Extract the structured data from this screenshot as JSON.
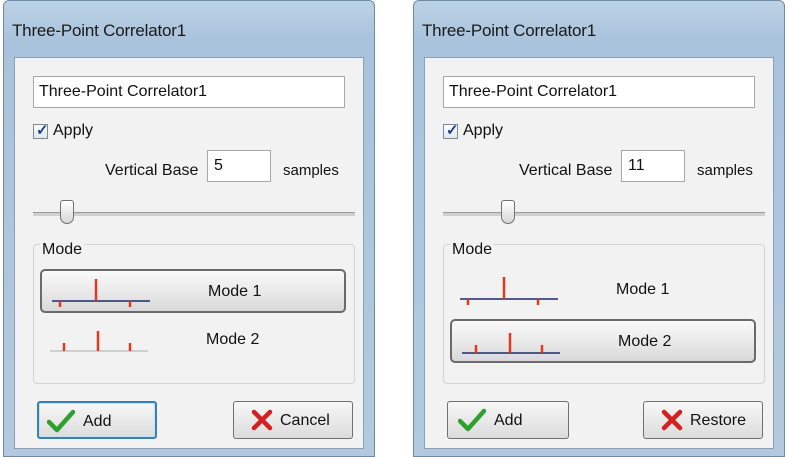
{
  "left": {
    "title": "Three-Point Correlator1",
    "name_value": "Three-Point Correlator1",
    "apply_label": "Apply",
    "vertical_base_label": "Vertical Base",
    "vertical_base_value": "5",
    "samples_label": "samples",
    "mode_label": "Mode",
    "mode1_label": "Mode 1",
    "mode2_label": "Mode 2",
    "selected_mode": "Mode 1",
    "add_label": "Add",
    "cancel_label": "Cancel"
  },
  "right": {
    "title": "Three-Point Correlator1",
    "name_value": "Three-Point Correlator1",
    "apply_label": "Apply",
    "vertical_base_label": "Vertical Base",
    "vertical_base_value": "11",
    "samples_label": "samples",
    "mode_label": "Mode",
    "mode1_label": "Mode 1",
    "mode2_label": "Mode 2",
    "selected_mode": "Mode 2",
    "add_label": "Add",
    "restore_label": "Restore"
  },
  "icons": {
    "checkbox_checked": "checkmark",
    "add": "green-checkmark-icon",
    "cancel": "red-x-icon",
    "restore": "red-x-icon"
  },
  "colors": {
    "mode_marker": "#e03a1e",
    "add_icon": "#2ea02e",
    "cancel_icon": "#d42020"
  }
}
